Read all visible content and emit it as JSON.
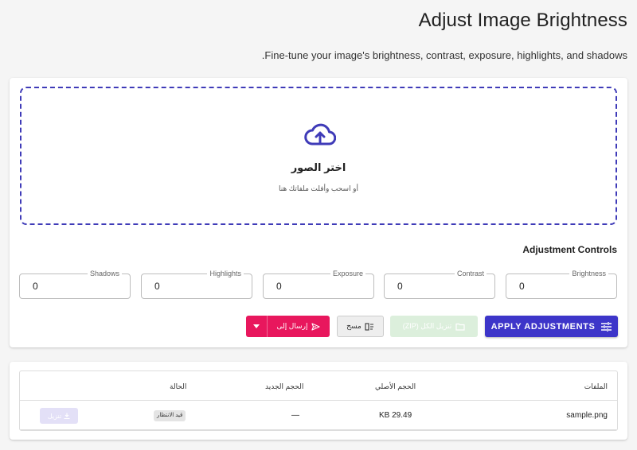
{
  "header": {
    "title": "Adjust Image Brightness",
    "subtitle": "Fine-tune your image's brightness, contrast, exposure, highlights, and shadows."
  },
  "dropzone": {
    "icon": "cloud-upload-icon",
    "title": "اختر الصور",
    "hint": "أو اسحب وأفلت ملفاتك هنا"
  },
  "controls": {
    "title": "Adjustment Controls",
    "fields": [
      {
        "label": "Brightness",
        "value": "0"
      },
      {
        "label": "Contrast",
        "value": "0"
      },
      {
        "label": "Exposure",
        "value": "0"
      },
      {
        "label": "Highlights",
        "value": "0"
      },
      {
        "label": "Shadows",
        "value": "0"
      }
    ]
  },
  "actions": {
    "apply": "APPLY ADJUSTMENTS",
    "download_zip": "تنزيل الكل (ZIP)",
    "clear": "مسح",
    "send": "إرسال إلى"
  },
  "table": {
    "headers": [
      "الملفات",
      "الحجم الأصلي",
      "الحجم الجديد",
      "الحالة"
    ],
    "rows": [
      {
        "file": "sample.png",
        "original_size": "29.49 KB",
        "new_size": "—",
        "status": "قيد الانتظار",
        "download": "تنزيل"
      }
    ]
  },
  "colors": {
    "primary": "#3d35c9",
    "send": "#e8175d",
    "zip_disabled": "#dcefdc"
  }
}
